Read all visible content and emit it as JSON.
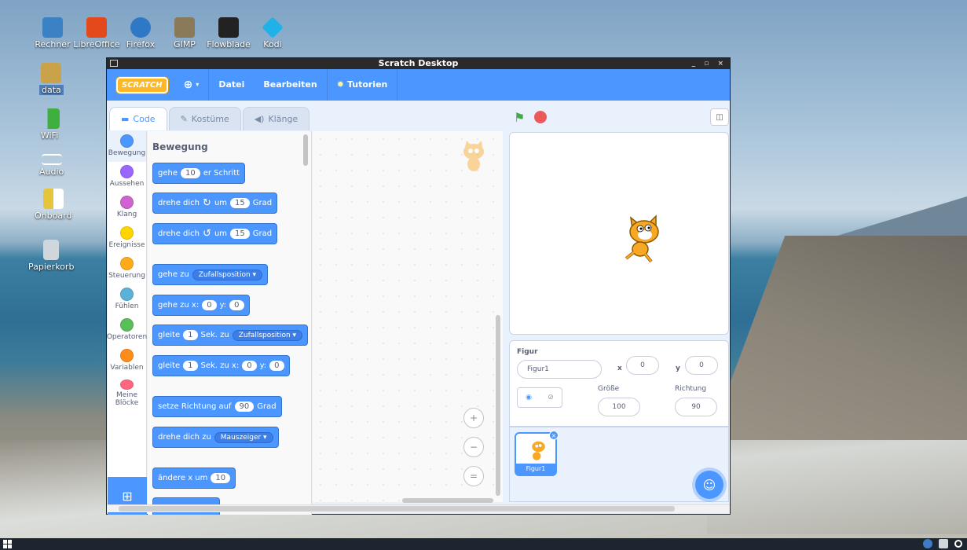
{
  "desktop": {
    "top_icons": [
      {
        "label": "Rechner",
        "icon": "computer-icon",
        "color": "#3b82c4"
      },
      {
        "label": "LibreOffice",
        "icon": "office-icon",
        "color": "#e3491a"
      },
      {
        "label": "Firefox",
        "icon": "globe-icon",
        "color": "#2f78c6"
      },
      {
        "label": "GIMP",
        "icon": "gimp-icon",
        "color": "#8a7a5a"
      },
      {
        "label": "Flowblade",
        "icon": "film-icon",
        "color": "#222222"
      },
      {
        "label": "Kodi",
        "icon": "kodi-icon",
        "color": "#1fb2e8"
      }
    ],
    "left_icons": [
      {
        "label": "data",
        "icon": "folder-icon",
        "color": "#c9a24a"
      },
      {
        "label": "WiFi",
        "icon": "wifi-icon",
        "color": "#3fb040"
      },
      {
        "label": "Audio",
        "icon": "audio-icon",
        "color": "#ffffff"
      },
      {
        "label": "Onboard",
        "icon": "keyboard-icon",
        "color": "#e7c53a"
      },
      {
        "label": "Papierkorb",
        "icon": "trash-icon",
        "color": "#cfd6dc"
      }
    ]
  },
  "window": {
    "title": "Scratch Desktop",
    "controls": "_ ▫ ×"
  },
  "menubar": {
    "logo": "SCRATCH",
    "items": [
      "Datei",
      "Bearbeiten",
      "Tutorien"
    ]
  },
  "tabs": [
    "Code",
    "Kostüme",
    "Klänge"
  ],
  "categories": [
    {
      "label": "Bewegung",
      "color": "#4c97ff"
    },
    {
      "label": "Aussehen",
      "color": "#9966ff"
    },
    {
      "label": "Klang",
      "color": "#cf63cf"
    },
    {
      "label": "Ereignisse",
      "color": "#ffd500"
    },
    {
      "label": "Steuerung",
      "color": "#ffab19"
    },
    {
      "label": "Fühlen",
      "color": "#5cb1d6"
    },
    {
      "label": "Operatoren",
      "color": "#59c059"
    },
    {
      "label": "Variablen",
      "color": "#ff8c1a"
    },
    {
      "label": "Meine Blöcke",
      "color": "#ff6680"
    }
  ],
  "palette": {
    "title": "Bewegung",
    "blocks": {
      "b1": {
        "pre": "gehe",
        "v1": "10",
        "post": "er Schritt"
      },
      "b2": {
        "pre": "drehe dich",
        "icon": "↻",
        "mid": "um",
        "v1": "15",
        "post": "Grad"
      },
      "b3": {
        "pre": "drehe dich",
        "icon": "↺",
        "mid": "um",
        "v1": "15",
        "post": "Grad"
      },
      "b4": {
        "pre": "gehe zu",
        "dd": "Zufallsposition ▾"
      },
      "b5": {
        "pre": "gehe zu x:",
        "v1": "0",
        "mid": "y:",
        "v2": "0"
      },
      "b6": {
        "pre": "gleite",
        "v1": "1",
        "mid": "Sek. zu",
        "dd": "Zufallsposition ▾"
      },
      "b7": {
        "pre": "gleite",
        "v1": "1",
        "mid": "Sek. zu x:",
        "v2": "0",
        "mid2": "y:",
        "v3": "0"
      },
      "b8": {
        "pre": "setze Richtung auf",
        "v1": "90",
        "post": "Grad"
      },
      "b9": {
        "pre": "drehe dich zu",
        "dd": "Mauszeiger ▾"
      },
      "b10": {
        "pre": "ändere x um",
        "v1": "10"
      }
    }
  },
  "zoom": {
    "in": "+",
    "out": "−",
    "reset": "="
  },
  "sprite_info": {
    "label": "Figur",
    "name": "Figur1",
    "x_label": "x",
    "x": "0",
    "y_label": "y",
    "y": "0",
    "size_label": "Größe",
    "size": "100",
    "direction_label": "Richtung",
    "direction": "90"
  },
  "sprites": [
    {
      "name": "Figur1"
    }
  ]
}
